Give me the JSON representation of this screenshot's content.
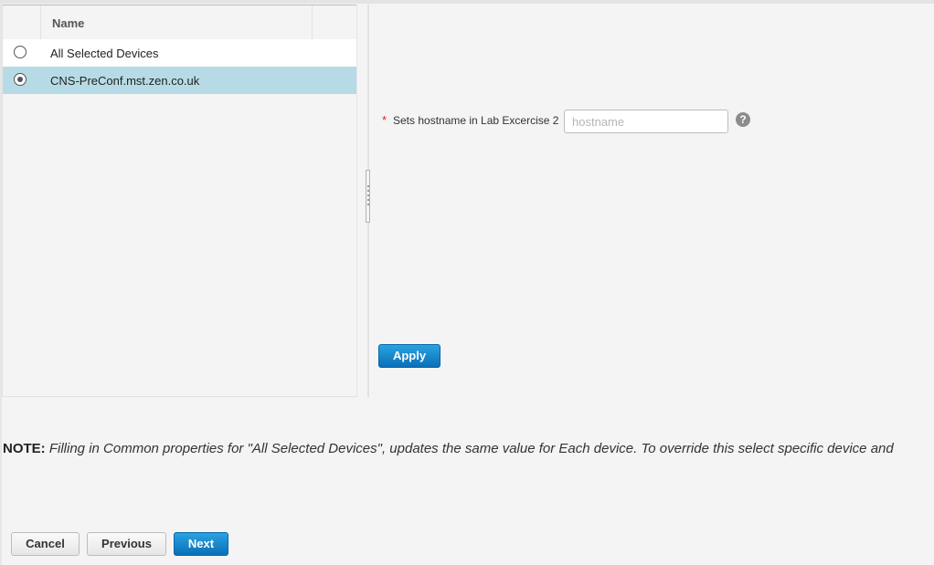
{
  "table": {
    "columns": [
      {
        "label": ""
      },
      {
        "label": "Name"
      },
      {
        "label": ""
      }
    ],
    "rows": [
      {
        "label": "All Selected Devices",
        "selected": false
      },
      {
        "label": "CNS-PreConf.mst.zen.co.uk",
        "selected": true
      }
    ]
  },
  "form": {
    "required_marker": "*",
    "hostname_label": "Sets hostname in Lab Excercise 2",
    "hostname_value": "",
    "hostname_placeholder": "hostname",
    "help_glyph": "?"
  },
  "buttons": {
    "apply": "Apply",
    "cancel": "Cancel",
    "previous": "Previous",
    "next": "Next"
  },
  "note": {
    "prefix": "NOTE:",
    "text": "Filling in Common properties for \"All Selected Devices\", updates the same value for Each device. To override this select specific device and"
  },
  "colors": {
    "selected_row": "#b7dbe6",
    "primary_button": "#0a6fb8",
    "required": "#e02020"
  }
}
